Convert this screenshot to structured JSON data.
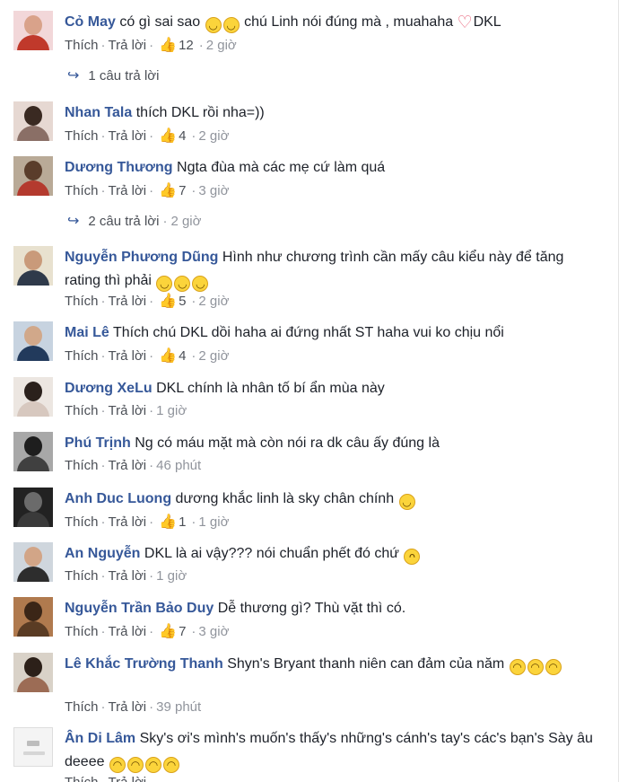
{
  "ui": {
    "like_label": "Thích",
    "reply_label": "Trả lời",
    "sep": "·",
    "thumb_glyph": "👍",
    "reply_arrow": "↪"
  },
  "colors": {
    "name": "#365899",
    "meta": "#90949c",
    "text": "#1d2129",
    "like_icon": "#4a6fb5"
  },
  "comments": [
    {
      "name": "Cỏ May",
      "text_parts": [
        {
          "type": "text",
          "value": " có gì sai sao "
        },
        {
          "type": "emoji",
          "value": "relieved-face-icon",
          "glyph": "◡"
        },
        {
          "type": "emoji",
          "value": "relieved-face-icon",
          "glyph": "◡"
        },
        {
          "type": "text",
          "value": " chú Linh nói đúng mà , muahaha "
        },
        {
          "type": "heart",
          "value": "heart-icon",
          "glyph": "♡"
        },
        {
          "type": "text",
          "value": "DKL"
        }
      ],
      "likes": "12",
      "time": "2 giờ",
      "replies": "1 câu trả lời",
      "replies_time": ""
    },
    {
      "name": "Nhan Tala",
      "text_parts": [
        {
          "type": "text",
          "value": " thích DKL rồi nha=))"
        }
      ],
      "likes": "4",
      "time": "2 giờ"
    },
    {
      "name": "Dương Thương",
      "text_parts": [
        {
          "type": "text",
          "value": " Ngta đùa mà các mẹ cứ làm quá"
        }
      ],
      "likes": "7",
      "time": "3 giờ",
      "replies": "2 câu trả lời",
      "replies_time": "2 giờ"
    },
    {
      "name": "Nguyễn Phương Dũng",
      "text_parts": [
        {
          "type": "text",
          "value": " Hình như chương trình cần mấy câu kiểu này để tăng rating thì phải "
        },
        {
          "type": "emoji",
          "value": "relieved-face-icon",
          "glyph": "◡"
        },
        {
          "type": "emoji",
          "value": "relieved-face-icon",
          "glyph": "◡"
        },
        {
          "type": "emoji",
          "value": "relieved-face-icon",
          "glyph": "◡"
        }
      ],
      "likes": "5",
      "time": "2 giờ"
    },
    {
      "name": "Mai Lê",
      "text_parts": [
        {
          "type": "text",
          "value": " Thích chú DKL dồi haha ai đứng nhất ST haha vui ko chịu nổi"
        }
      ],
      "likes": "4",
      "time": "2 giờ"
    },
    {
      "name": "Dương XeLu",
      "text_parts": [
        {
          "type": "text",
          "value": " DKL chính là nhân tố bí ẩn mùa này"
        }
      ],
      "likes": "",
      "time": "1 giờ"
    },
    {
      "name": "Phú Trịnh",
      "text_parts": [
        {
          "type": "text",
          "value": " Ng có máu mặt mà còn nói ra dk câu ấy đúng là"
        }
      ],
      "likes": "",
      "time": "46 phút"
    },
    {
      "name": "Anh Duc Luong",
      "text_parts": [
        {
          "type": "text",
          "value": " dương khắc linh là sky chân chính "
        },
        {
          "type": "emoji",
          "value": "smile-face-icon",
          "glyph": "◡"
        }
      ],
      "likes": "1",
      "time": "1 giờ"
    },
    {
      "name": "An Nguyễn",
      "text_parts": [
        {
          "type": "text",
          "value": " DKL là ai vậy??? nói chuẩn phết đó chứ "
        },
        {
          "type": "emoji",
          "value": "tongue-face-icon",
          "glyph": "ᴖ"
        }
      ],
      "likes": "",
      "time": "1 giờ"
    },
    {
      "name": "Nguyễn Trần Bảo Duy",
      "text_parts": [
        {
          "type": "text",
          "value": " Dễ thương gì? Thù vặt thì có."
        }
      ],
      "likes": "7",
      "time": "3 giờ"
    },
    {
      "name": "Lê Khắc Trường Thanh",
      "text_parts": [
        {
          "type": "text",
          "value": " Shyn's Bryant thanh niên can đảm của năm "
        },
        {
          "type": "emoji",
          "value": "laughing-face-icon",
          "glyph": "◠"
        },
        {
          "type": "emoji",
          "value": "laughing-face-icon",
          "glyph": "◠"
        },
        {
          "type": "emoji",
          "value": "laughing-face-icon",
          "glyph": "◠"
        }
      ],
      "likes": "",
      "time": "39 phút"
    },
    {
      "name": "Ân Di Lâm",
      "text_parts": [
        {
          "type": "text",
          "value": " Sky's ơi's mình's muốn's thấy's những's cánh's tay's các's bạn's Sày âu deeee "
        },
        {
          "type": "emoji",
          "value": "laughing-face-icon",
          "glyph": "◠"
        },
        {
          "type": "emoji",
          "value": "laughing-face-icon",
          "glyph": "◠"
        },
        {
          "type": "emoji",
          "value": "laughing-face-icon",
          "glyph": "◠"
        },
        {
          "type": "emoji",
          "value": "laughing-face-icon",
          "glyph": "◠"
        }
      ],
      "likes": "",
      "time": ""
    }
  ]
}
